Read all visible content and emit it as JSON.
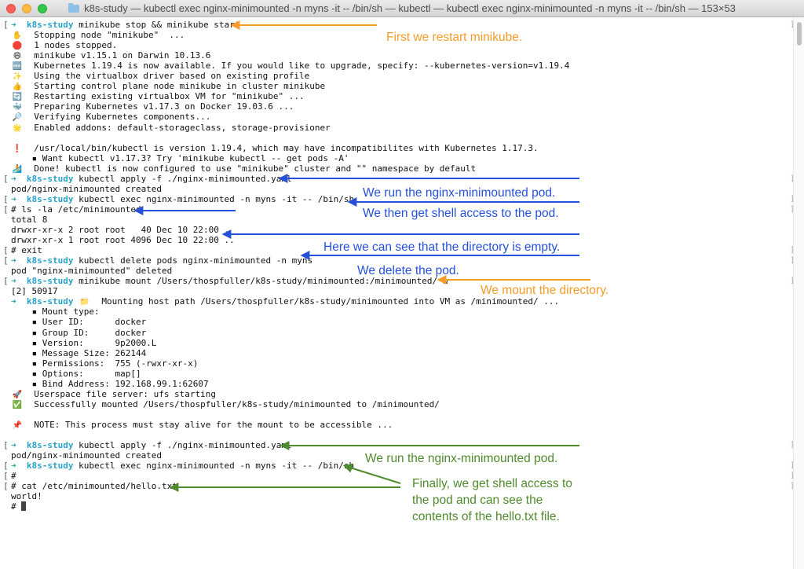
{
  "window": {
    "title": "k8s-study — kubectl exec nginx-minimounted -n myns -it -- /bin/sh — kubectl — kubectl exec nginx-minimounted -n myns -it -- /bin/sh — 153×53"
  },
  "prompt": {
    "arrow": "➜",
    "name": "k8s-study"
  },
  "terminal": {
    "lines": [
      {
        "gutter": "[",
        "prompt": true,
        "text": " minikube stop && minikube start"
      },
      {
        "emoji": "✋",
        "text": "Stopping node \"minikube\"  ..."
      },
      {
        "emoji": "🛑",
        "text": "1 nodes stopped."
      },
      {
        "emoji": "😄",
        "text": "minikube v1.15.1 on Darwin 10.13.6"
      },
      {
        "emoji": "🆕",
        "text": "Kubernetes 1.19.4 is now available. If you would like to upgrade, specify: --kubernetes-version=v1.19.4"
      },
      {
        "emoji": "✨",
        "text": "Using the virtualbox driver based on existing profile"
      },
      {
        "emoji": "👍",
        "text": "Starting control plane node minikube in cluster minikube"
      },
      {
        "emoji": "🔄",
        "text": "Restarting existing virtualbox VM for \"minikube\" ..."
      },
      {
        "emoji": "🐳",
        "text": "Preparing Kubernetes v1.17.3 on Docker 19.03.6 ..."
      },
      {
        "emoji": "🔎",
        "text": "Verifying Kubernetes components..."
      },
      {
        "emoji": "🌟",
        "text": "Enabled addons: default-storageclass, storage-provisioner"
      },
      {
        "text": ""
      },
      {
        "emoji": "❗",
        "text": "/usr/local/bin/kubectl is version 1.19.4, which may have incompatibilites with Kubernetes 1.17.3."
      },
      {
        "text": "    ▪ Want kubectl v1.17.3? Try 'minikube kubectl -- get pods -A'"
      },
      {
        "emoji": "🏄",
        "text": "Done! kubectl is now configured to use \"minikube\" cluster and \"\" namespace by default"
      },
      {
        "gutter": "[",
        "prompt": true,
        "text": " kubectl apply -f ./nginx-minimounted.yaml"
      },
      {
        "text": "pod/nginx-minimounted created"
      },
      {
        "gutter": "[",
        "prompt": true,
        "text": " kubectl exec nginx-minimounted -n myns -it -- /bin/sh"
      },
      {
        "gutter": "[",
        "text": "# ls -la /etc/minimounted"
      },
      {
        "text": "total 8"
      },
      {
        "text": "drwxr-xr-x 2 root root   40 Dec 10 22:00 ."
      },
      {
        "text": "drwxr-xr-x 1 root root 4096 Dec 10 22:00 .."
      },
      {
        "gutter": "[",
        "text": "# exit"
      },
      {
        "gutter": "[",
        "prompt": true,
        "text": " kubectl delete pods nginx-minimounted -n myns"
      },
      {
        "text": "pod \"nginx-minimounted\" deleted"
      },
      {
        "gutter": "[",
        "prompt": true,
        "text": " minikube mount /Users/thospfuller/k8s-study/minimounted:/minimounted/ &"
      },
      {
        "text": "[2] 50917"
      },
      {
        "prompt": true,
        "emoji": "📁",
        "text": "Mounting host path /Users/thospfuller/k8s-study/minimounted into VM as /minimounted/ ..."
      },
      {
        "text": "    ▪ Mount type:"
      },
      {
        "text": "    ▪ User ID:      docker"
      },
      {
        "text": "    ▪ Group ID:     docker"
      },
      {
        "text": "    ▪ Version:      9p2000.L"
      },
      {
        "text": "    ▪ Message Size: 262144"
      },
      {
        "text": "    ▪ Permissions:  755 (-rwxr-xr-x)"
      },
      {
        "text": "    ▪ Options:      map[]"
      },
      {
        "text": "    ▪ Bind Address: 192.168.99.1:62607"
      },
      {
        "emoji": "🚀",
        "text": "Userspace file server: ufs starting"
      },
      {
        "emoji": "✅",
        "text": "Successfully mounted /Users/thospfuller/k8s-study/minimounted to /minimounted/"
      },
      {
        "text": ""
      },
      {
        "emoji": "📌",
        "text": "NOTE: This process must stay alive for the mount to be accessible ..."
      },
      {
        "text": ""
      },
      {
        "gutter": "[",
        "prompt": true,
        "text": " kubectl apply -f ./nginx-minimounted.yaml"
      },
      {
        "text": "pod/nginx-minimounted created"
      },
      {
        "gutter": "[",
        "prompt": true,
        "text": " kubectl exec nginx-minimounted -n myns -it -- /bin/sh"
      },
      {
        "gutter": "[",
        "text": "#"
      },
      {
        "gutter": "[",
        "text": "# cat /etc/minimounted/hello.txt"
      },
      {
        "text": "world!"
      },
      {
        "text": "# ",
        "cursor": true
      }
    ]
  },
  "annotations": {
    "restart": "First we restart minikube.",
    "run_pod_1": "We run the nginx-minimounted pod.",
    "shell_1": "We then get shell access to the pod.",
    "empty_dir": "Here we can see that the directory is empty.",
    "delete_pod": "We delete the pod.",
    "mount_dir": "We mount the directory.",
    "run_pod_2": "We run the nginx-minimounted pod.",
    "final_1": "Finally, we get shell access to",
    "final_2": "the pod and can see the",
    "final_3": "contents of the hello.txt file."
  },
  "colors": {
    "blue": "#2750d9",
    "orange": "#f59c2a",
    "green": "#4f8a2d",
    "prompt": "#2aa2c9"
  }
}
